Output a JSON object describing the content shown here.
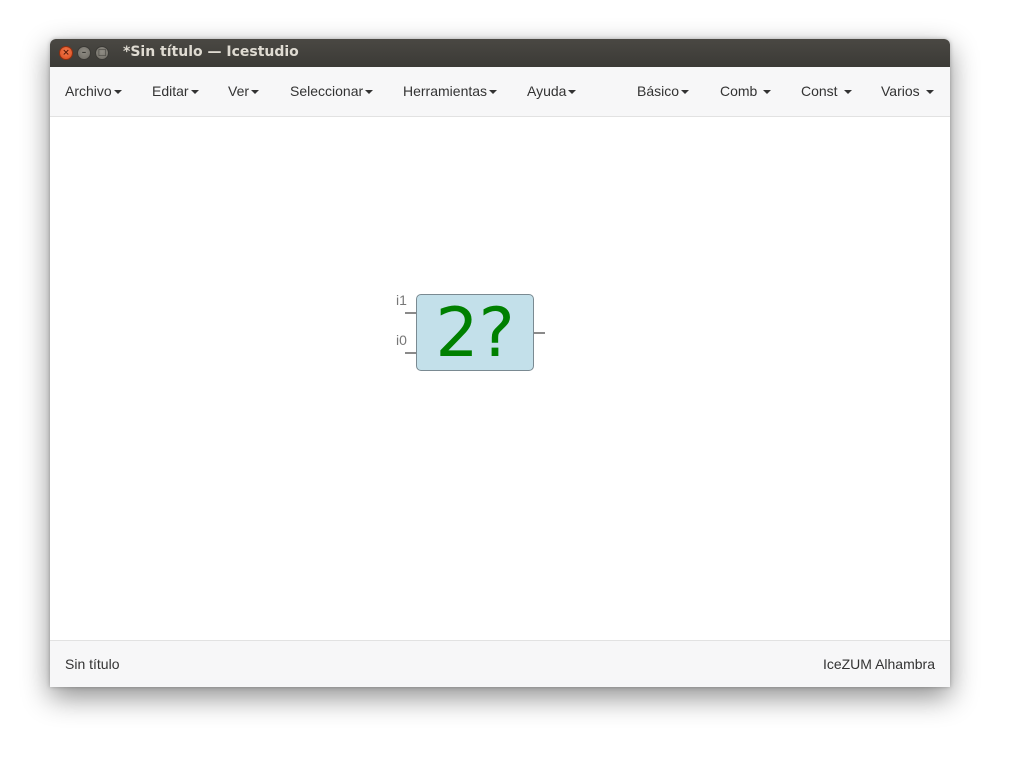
{
  "window": {
    "title": "*Sin título — Icestudio",
    "buttons": {
      "close": "×",
      "minimize": "–",
      "maximize": "□"
    }
  },
  "menubar": {
    "left_menus": [
      "Archivo",
      "Editar",
      "Ver",
      "Seleccionar",
      "Herramientas",
      "Ayuda"
    ],
    "right_menus": [
      "Básico",
      "Comb",
      "Const",
      "Varios"
    ]
  },
  "canvas": {
    "block": {
      "label": "2?",
      "label_color": "#008000",
      "fill_color": "#c3e0ea",
      "inputs": [
        "i1",
        "i0"
      ]
    }
  },
  "statusbar": {
    "file_name": "Sin título",
    "board": "IceZUM Alhambra"
  }
}
